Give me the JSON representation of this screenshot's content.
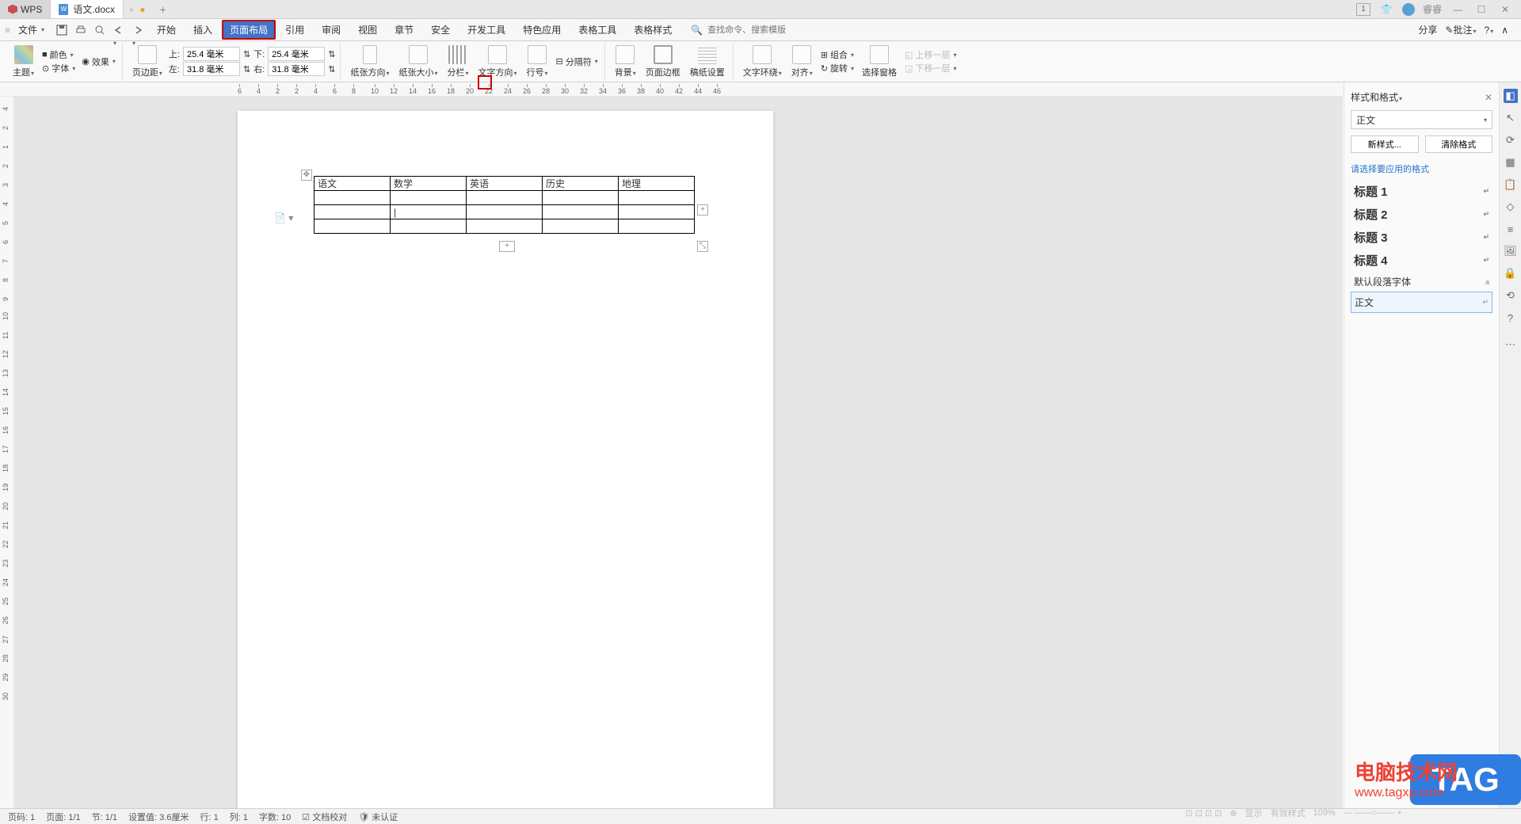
{
  "titlebar": {
    "app": "WPS",
    "doc_tab": "语文.docx",
    "badge": "1",
    "user": "睿睿"
  },
  "menu": {
    "file": "文件",
    "items": [
      "开始",
      "插入",
      "页面布局",
      "引用",
      "审阅",
      "视图",
      "章节",
      "安全",
      "开发工具",
      "特色应用",
      "表格工具",
      "表格样式"
    ],
    "search_placeholder": "查找命令、搜索模版",
    "share": "分享",
    "annotate": "批注"
  },
  "ribbon": {
    "theme": "主题",
    "color": "颜色",
    "font": "字体",
    "effect": "效果",
    "margins": "页边距",
    "top_label": "上:",
    "top_val": "25.4 毫米",
    "bottom_label": "下:",
    "bottom_val": "25.4 毫米",
    "left_label": "左:",
    "left_val": "31.8 毫米",
    "right_label": "右:",
    "right_val": "31.8 毫米",
    "orientation": "纸张方向",
    "size": "纸张大小",
    "columns": "分栏",
    "textdir": "文字方向",
    "linenum": "行号",
    "breaks": "分隔符",
    "background": "背景",
    "border": "页面边框",
    "manuscript": "稿纸设置",
    "wrap": "文字环绕",
    "align": "对齐",
    "rotate": "旋转",
    "combine": "组合",
    "selection": "选择窗格",
    "bringfw": "上移一层",
    "sendbk": "下移一层"
  },
  "table": {
    "headers": [
      "语文",
      "数学",
      "英语",
      "历史",
      "地理"
    ]
  },
  "sidepanel": {
    "title": "样式和格式",
    "current": "正文",
    "new_btn": "新样式...",
    "clear_btn": "清除格式",
    "subtitle": "请选择要应用的格式",
    "items": [
      {
        "label": "标题 1",
        "h": true
      },
      {
        "label": "标题 2",
        "h": true
      },
      {
        "label": "标题 3",
        "h": true
      },
      {
        "label": "标题 4",
        "h": true
      },
      {
        "label": "默认段落字体",
        "h": false
      },
      {
        "label": "正文",
        "h": false,
        "selected": true
      }
    ]
  },
  "statusbar": {
    "pagenum": "页码: 1",
    "pages": "页面: 1/1",
    "section": "节: 1/1",
    "setval": "设置值: 3.6厘米",
    "row": "行: 1",
    "col": "列: 1",
    "words": "字数: 10",
    "proofing": "文档校对",
    "cert": "未认证",
    "zoom": "109%"
  },
  "watermark": {
    "line1": "电脑技术网",
    "line2": "www.tagxp.com",
    "tag": "TAG"
  },
  "washed": {
    "show": "显示",
    "effective": "有效样式"
  },
  "ruler_h": [
    -6,
    -4,
    -2,
    2,
    4,
    6,
    8,
    10,
    12,
    14,
    16,
    18,
    20,
    22,
    24,
    26,
    28,
    30,
    32,
    34,
    36,
    38,
    40,
    42,
    44,
    46
  ],
  "ruler_v": [
    -4,
    -2,
    1,
    2,
    3,
    4,
    5,
    6,
    7,
    8,
    9,
    10,
    11,
    12,
    13,
    14,
    15,
    16,
    17,
    18,
    19,
    20,
    21,
    22,
    23,
    24,
    25,
    26,
    27,
    28,
    29,
    30
  ]
}
